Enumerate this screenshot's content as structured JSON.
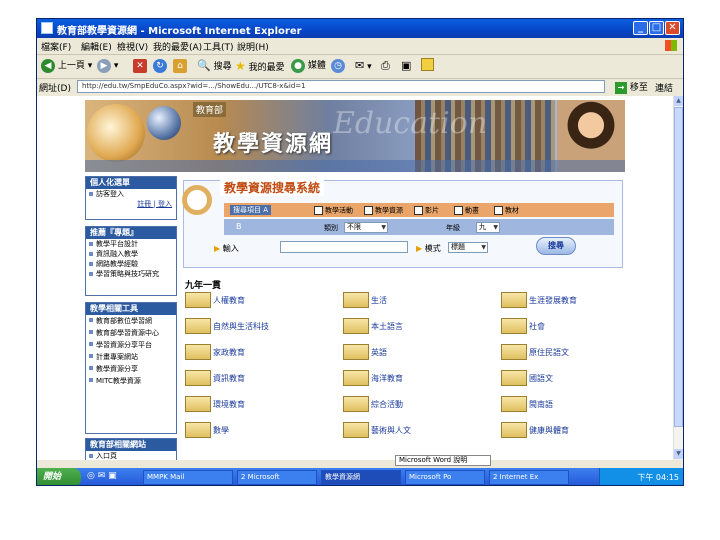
{
  "window": {
    "title": "教育部教學資源網 - Microsoft Internet Explorer",
    "minimize": "_",
    "maximize": "□",
    "close": "✕"
  },
  "menu": {
    "items": [
      "檔案(F)",
      "編輯(E)",
      "檢視(V)",
      "我的最愛(A)",
      "工具(T)",
      "說明(H)"
    ]
  },
  "toolbar": {
    "back": "上一頁",
    "search": "搜尋",
    "favorites": "我的最愛",
    "media": "媒體"
  },
  "address": {
    "label": "網址(D)",
    "url": "http://edu.tw/SmpEduCo.aspx?wid=.../ShowEdu.../UTC8-x&id=1",
    "go": "移至",
    "links": "連結"
  },
  "banner": {
    "ministry": "教育部",
    "brand": "教學資源網",
    "watermark": "Education"
  },
  "left_panel": {
    "personal": {
      "header": "個人化選單",
      "items": [
        "訪客登入"
      ],
      "links": "註冊 | 登入"
    },
    "topics": {
      "header": "推薦『專題』",
      "items": [
        "教學平台設計",
        "資訊融入教學",
        "網路教學經驗",
        "學習策略與技巧研究"
      ]
    },
    "related": {
      "header": "教學相關工具",
      "items": [
        "教育部數位學習網",
        "教育部學習資源中心",
        "學習資源分享平台",
        "計畫專案網站",
        "教學資源分享",
        "MITC教學資源"
      ]
    },
    "other": {
      "header": "教育部相關網站",
      "items": [
        "入口頁"
      ]
    }
  },
  "search": {
    "title": "教學資源搜尋系統",
    "tag_a": "搜尋項目 A",
    "tag_b": "B",
    "checkboxes": [
      "教學活動",
      "教學資源",
      "影片",
      "動畫",
      "教材"
    ],
    "select1_label": "類別",
    "select1_value": "不限",
    "select2_label": "年級",
    "select2_value": "九",
    "input_label": "輸入",
    "mode_label": "模式",
    "mode_value": "標題",
    "button": "搜尋"
  },
  "grade": {
    "title": "九年一貫",
    "subjects": [
      "人權教育",
      "生活",
      "生涯發展教育",
      "自然與生活科技",
      "本土語言",
      "社會",
      "家政教育",
      "英語",
      "原住民語文",
      "資訊教育",
      "海洋教育",
      "國語文",
      "環境教育",
      "綜合活動",
      "閩南語",
      "數學",
      "藝術與人文",
      "健康與體育"
    ]
  },
  "ime_tip": "Microsoft Word 說明",
  "taskbar": {
    "start": "開始",
    "tasks": [
      "MMPK Mail",
      "2 Microsoft",
      "教學資源網",
      "Microsoft Po",
      "2 Internet Ex"
    ],
    "clock": "下午 04:15"
  }
}
